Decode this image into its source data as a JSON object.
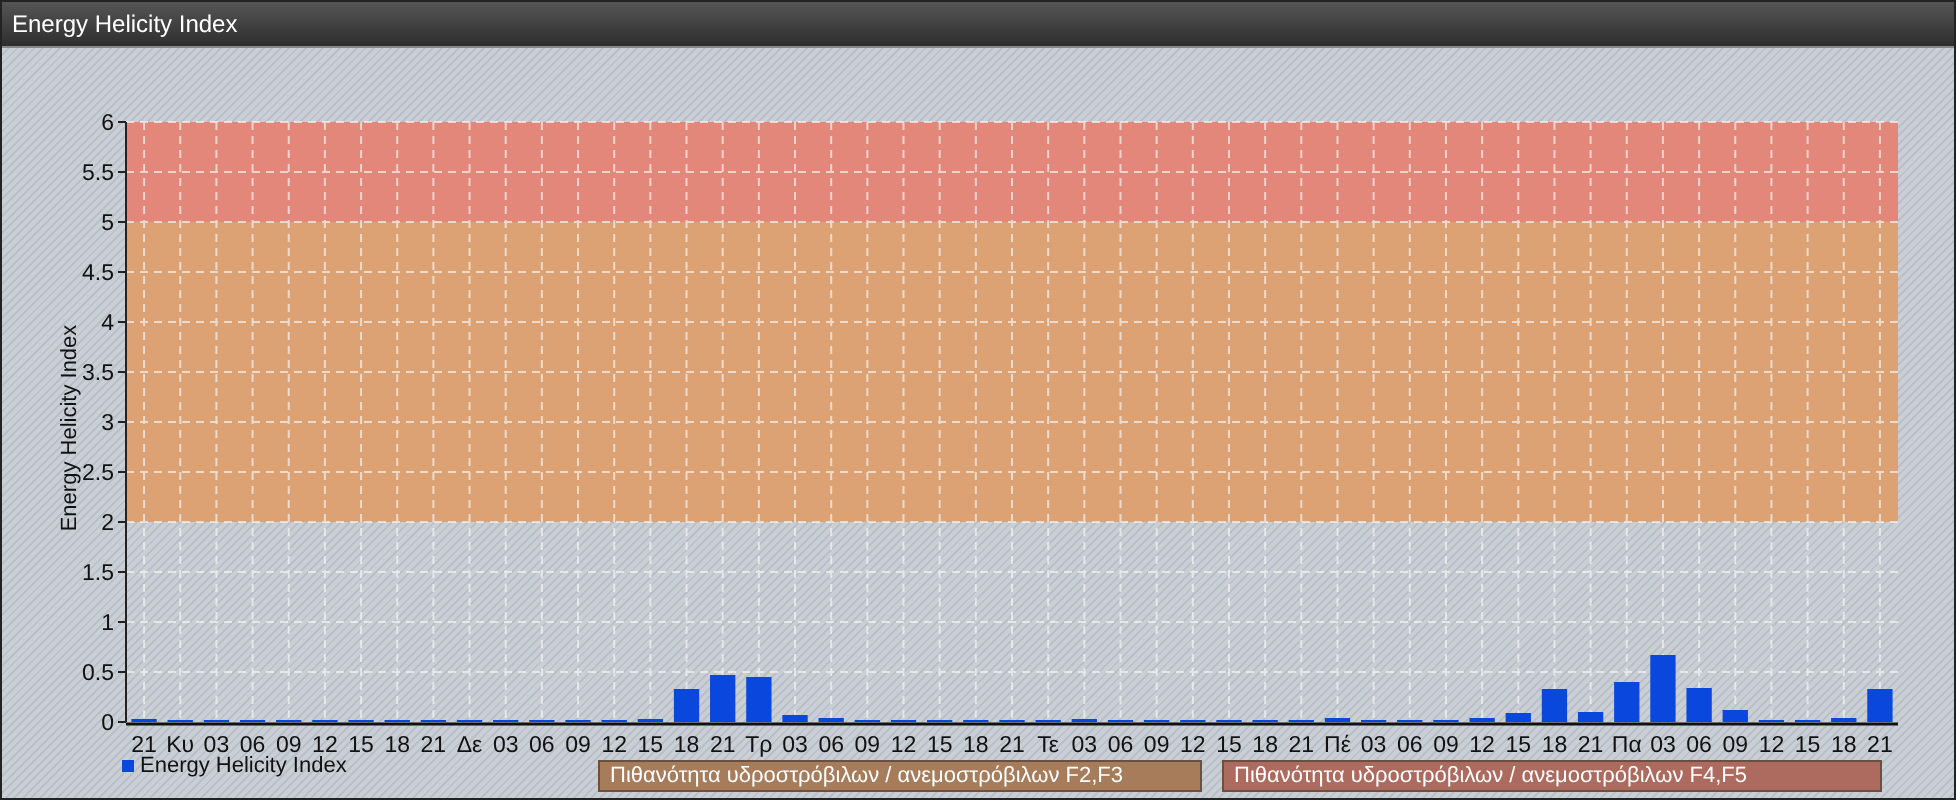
{
  "window": {
    "title": "Energy Helicity Index"
  },
  "chart": {
    "chart_data": {
      "type": "bar",
      "ylabel": "Energy Helicity Index",
      "ylim": [
        0,
        6
      ],
      "yticks": [
        0,
        0.5,
        1,
        1.5,
        2,
        2.5,
        3,
        3.5,
        4,
        4.5,
        5,
        5.5,
        6
      ],
      "categories": [
        "21",
        "Κυ",
        "03",
        "06",
        "09",
        "12",
        "15",
        "18",
        "21",
        "Δε",
        "03",
        "06",
        "09",
        "12",
        "15",
        "18",
        "21",
        "Τρ",
        "03",
        "06",
        "09",
        "12",
        "15",
        "18",
        "21",
        "Τε",
        "03",
        "06",
        "09",
        "12",
        "15",
        "18",
        "21",
        "Πέ",
        "03",
        "06",
        "09",
        "12",
        "15",
        "18",
        "21",
        "Πα",
        "03",
        "06",
        "09",
        "12",
        "15",
        "18",
        "21"
      ],
      "series": [
        {
          "name": "Energy Helicity Index",
          "color": "#0a47dc",
          "values": [
            0.03,
            0.02,
            0.02,
            0.02,
            0.02,
            0.02,
            0.02,
            0.02,
            0.02,
            0.02,
            0.02,
            0.02,
            0.02,
            0.02,
            0.03,
            0.33,
            0.47,
            0.45,
            0.07,
            0.04,
            0.02,
            0.02,
            0.02,
            0.02,
            0.02,
            0.02,
            0.03,
            0.02,
            0.02,
            0.02,
            0.02,
            0.02,
            0.02,
            0.04,
            0.02,
            0.02,
            0.02,
            0.04,
            0.09,
            0.33,
            0.1,
            0.4,
            0.67,
            0.34,
            0.12,
            0.02,
            0.02,
            0.04,
            0.33
          ]
        }
      ],
      "grid": true,
      "bands": [
        {
          "axis": "y",
          "from": 2,
          "to": 5,
          "color": "#dca273"
        },
        {
          "axis": "y",
          "from": 5,
          "to": 6,
          "color": "#e2877a"
        }
      ]
    },
    "notes": [
      {
        "text": "Πιθανότητα υδροστρόβιλων / ανεμοστρόβιλων F2,F3",
        "color": "#a67c5a"
      },
      {
        "text": "Πιθανότητα υδροστρόβιλων / ανεμοστρόβιλων F4,F5",
        "color": "#ad6a5e"
      }
    ]
  }
}
